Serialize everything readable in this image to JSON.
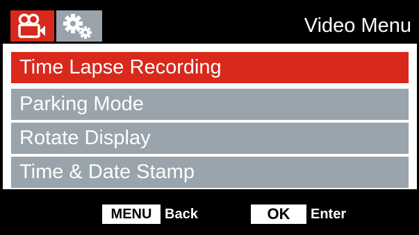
{
  "header": {
    "title": "Video Menu",
    "tabs": [
      {
        "icon": "video-camera-icon",
        "active": true
      },
      {
        "icon": "settings-gears-icon",
        "active": false
      }
    ]
  },
  "menu": {
    "items": [
      {
        "label": "Time Lapse Recording",
        "selected": true
      },
      {
        "label": "Parking Mode",
        "selected": false
      },
      {
        "label": "Rotate Display",
        "selected": false
      },
      {
        "label": "Time & Date Stamp",
        "selected": false
      }
    ]
  },
  "footer": {
    "menu_key": "MENU",
    "menu_action": "Back",
    "ok_key": "OK",
    "ok_action": "Enter"
  },
  "colors": {
    "accent": "#d8291c",
    "item_bg": "#99a4ac",
    "background": "#000000",
    "panel": "#ffffff"
  }
}
